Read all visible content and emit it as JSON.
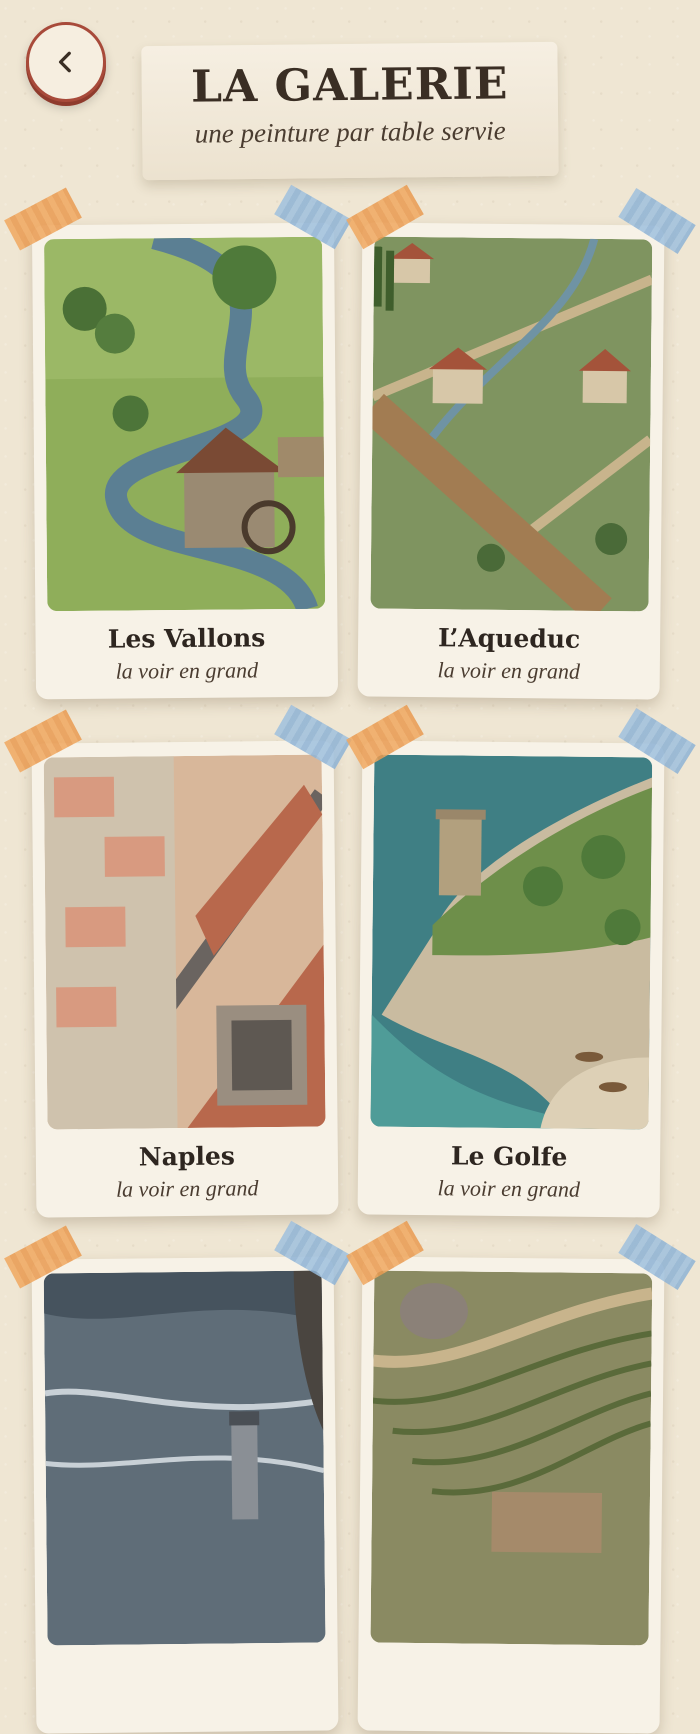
{
  "header": {
    "title": "LA GALERIE",
    "subtitle": "une peinture par table servie"
  },
  "gallery": {
    "cards": [
      {
        "name": "Les Vallons",
        "link": "la voir en grand"
      },
      {
        "name": "L’Aqueduc",
        "link": "la voir en grand"
      },
      {
        "name": "Naples",
        "link": "la voir en grand"
      },
      {
        "name": "Le Golfe",
        "link": "la voir en grand"
      },
      {
        "name": "",
        "link": ""
      },
      {
        "name": "",
        "link": ""
      }
    ]
  },
  "icons": {
    "back": "chevron-left-icon"
  },
  "colors": {
    "accent": "#a84a3a",
    "background": "#efe6d3",
    "card": "#f7f2e7",
    "tape_orange": "#f0a860",
    "tape_blue": "#9fc0de"
  }
}
